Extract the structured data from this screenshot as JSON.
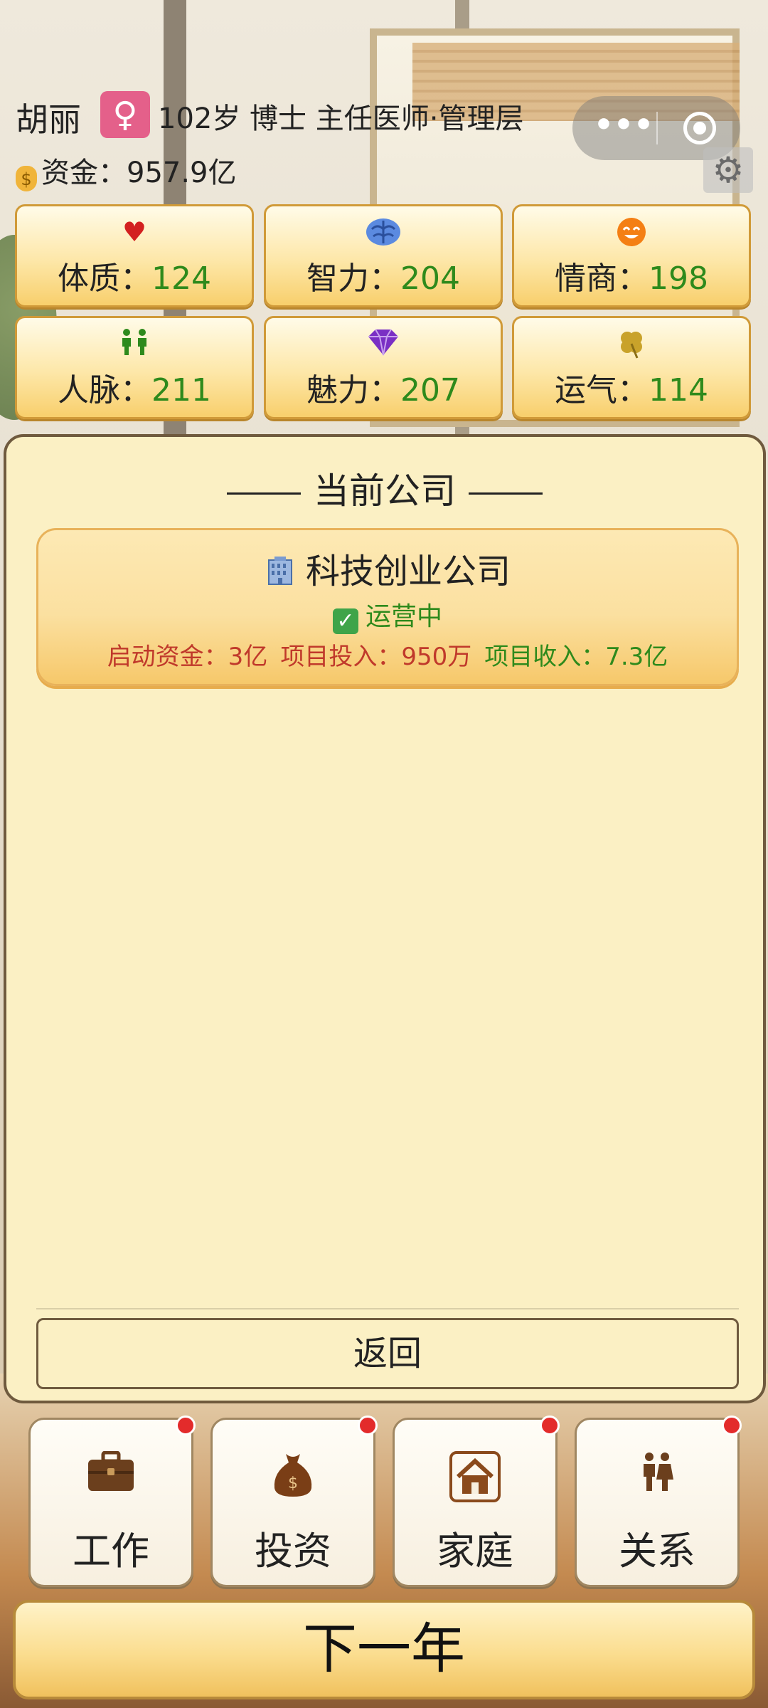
{
  "player": {
    "name": "胡丽",
    "gender_symbol": "♀",
    "info": "102岁 博士 主任医师·管理层",
    "money": "资金：957.9亿",
    "money_icon": "money-bag-icon"
  },
  "system": {
    "more_label": "•••",
    "settings_icon": "gear-icon"
  },
  "stats": [
    {
      "icon": "heart-icon",
      "glyph": "♥",
      "color": "#d32020",
      "label": "体质：",
      "value": "124"
    },
    {
      "icon": "brain-icon",
      "glyph": "🧠",
      "color": "#3a66c9",
      "label": "智力：",
      "value": "204"
    },
    {
      "icon": "smile-icon",
      "glyph": "☻",
      "color": "#f07a12",
      "label": "情商：",
      "value": "198"
    },
    {
      "icon": "people-icon",
      "glyph": "👫",
      "color": "#2e8a1c",
      "label": "人脉：",
      "value": "211"
    },
    {
      "icon": "diamond-icon",
      "glyph": "◆",
      "color": "#7a2fc4",
      "label": "魅力：",
      "value": "207"
    },
    {
      "icon": "clover-icon",
      "glyph": "♣",
      "color": "#c9a22a",
      "label": "运气：",
      "value": "114"
    }
  ],
  "panel": {
    "title": "当前公司",
    "company": {
      "icon": "office-building-icon",
      "name": "科技创业公司",
      "status": "运营中",
      "startup_capital": "启动资金：3亿",
      "project_investment": "项目投入：950万",
      "project_revenue": "项目收入：7.3亿"
    },
    "back_label": "返回"
  },
  "nav": [
    {
      "icon": "briefcase-icon",
      "label": "工作",
      "badge": true
    },
    {
      "icon": "money-sack-icon",
      "label": "投资",
      "badge": true
    },
    {
      "icon": "house-icon",
      "label": "家庭",
      "badge": true
    },
    {
      "icon": "couple-icon",
      "label": "关系",
      "badge": true
    }
  ],
  "next_year_label": "下一年",
  "colors": {
    "value_green": "#2e8a1c",
    "expense_red": "#c0392b",
    "panel_bg": "#fbf0c4",
    "badge_pink": "#e4608a"
  }
}
